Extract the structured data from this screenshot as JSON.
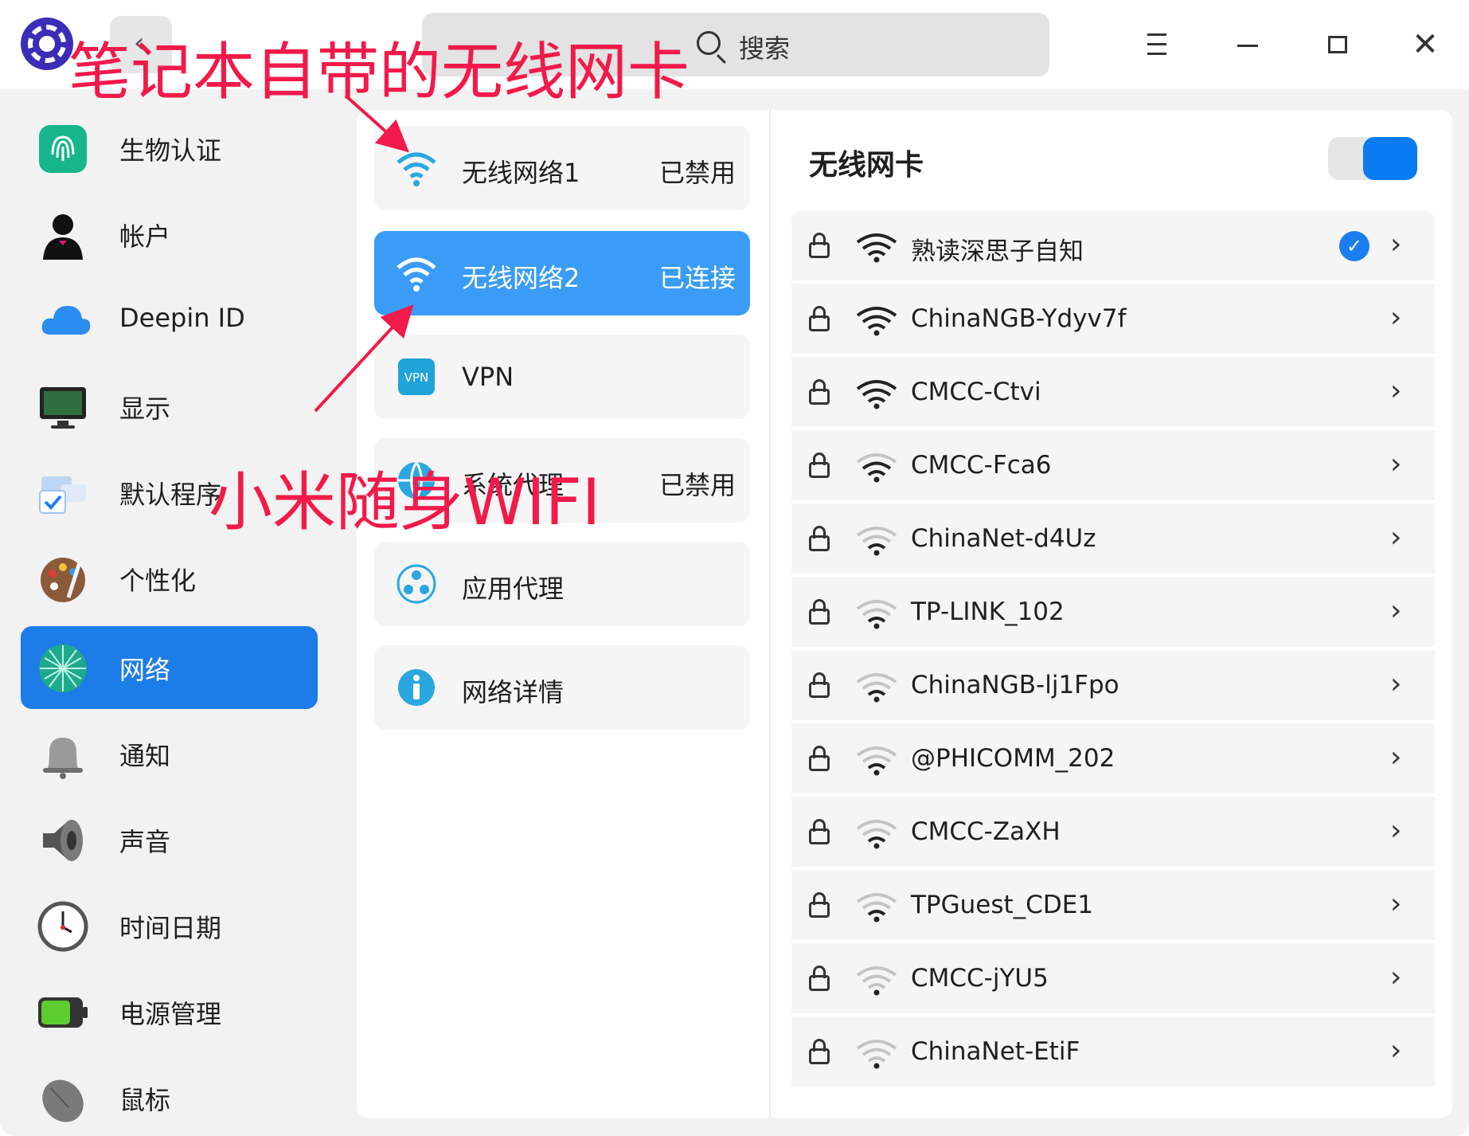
{
  "titlebar": {
    "search_placeholder": "搜索"
  },
  "sidebar": {
    "items": [
      {
        "label": "生物认证",
        "icon": "fingerprint-icon"
      },
      {
        "label": "帐户",
        "icon": "account-icon"
      },
      {
        "label": "Deepin ID",
        "icon": "cloud-icon"
      },
      {
        "label": "显示",
        "icon": "display-icon"
      },
      {
        "label": "默认程序",
        "icon": "default-apps-icon"
      },
      {
        "label": "个性化",
        "icon": "palette-icon"
      },
      {
        "label": "网络",
        "icon": "network-icon",
        "active": true
      },
      {
        "label": "通知",
        "icon": "bell-icon"
      },
      {
        "label": "声音",
        "icon": "speaker-icon"
      },
      {
        "label": "时间日期",
        "icon": "clock-icon"
      },
      {
        "label": "电源管理",
        "icon": "battery-icon"
      },
      {
        "label": "鼠标",
        "icon": "mouse-icon"
      }
    ]
  },
  "network_menu": {
    "items": [
      {
        "label": "无线网络1",
        "status": "已禁用",
        "icon": "wifi-icon"
      },
      {
        "label": "无线网络2",
        "status": "已连接",
        "icon": "wifi-icon",
        "active": true
      },
      {
        "label": "VPN",
        "status": "",
        "icon": "vpn-icon",
        "icon_text": "VPN"
      },
      {
        "label": "系统代理",
        "status": "已禁用",
        "icon": "globe-icon"
      },
      {
        "label": "应用代理",
        "status": "",
        "icon": "app-proxy-icon"
      },
      {
        "label": "网络详情",
        "status": "",
        "icon": "info-icon"
      }
    ]
  },
  "wireless_panel": {
    "title": "无线网卡",
    "enabled": true,
    "networks": [
      {
        "ssid": "熟读深思子自知",
        "signal": 4,
        "connected": true
      },
      {
        "ssid": "ChinaNGB-Ydyv7f",
        "signal": 4,
        "connected": false
      },
      {
        "ssid": "CMCC-Ctvi",
        "signal": 4,
        "connected": false
      },
      {
        "ssid": "CMCC-Fca6",
        "signal": 3,
        "connected": false
      },
      {
        "ssid": "ChinaNet-d4Uz",
        "signal": 2,
        "connected": false
      },
      {
        "ssid": "TP-LINK_102",
        "signal": 2,
        "connected": false
      },
      {
        "ssid": "ChinaNGB-lj1Fpo",
        "signal": 2,
        "connected": false
      },
      {
        "ssid": "@PHICOMM_202",
        "signal": 2,
        "connected": false
      },
      {
        "ssid": "CMCC-ZaXH",
        "signal": 2,
        "connected": false
      },
      {
        "ssid": "TPGuest_CDE1",
        "signal": 2,
        "connected": false
      },
      {
        "ssid": "CMCC-jYU5",
        "signal": 1,
        "connected": false
      },
      {
        "ssid": "ChinaNet-EtiF",
        "signal": 1,
        "connected": false
      }
    ]
  },
  "annotations": {
    "top": "笔记本自带的无线网卡",
    "bottom": "小米随身WIFI"
  },
  "colors": {
    "accent": "#1c7ce8",
    "annotation": "#f21a4a",
    "wifi": "#2aa7e0"
  }
}
